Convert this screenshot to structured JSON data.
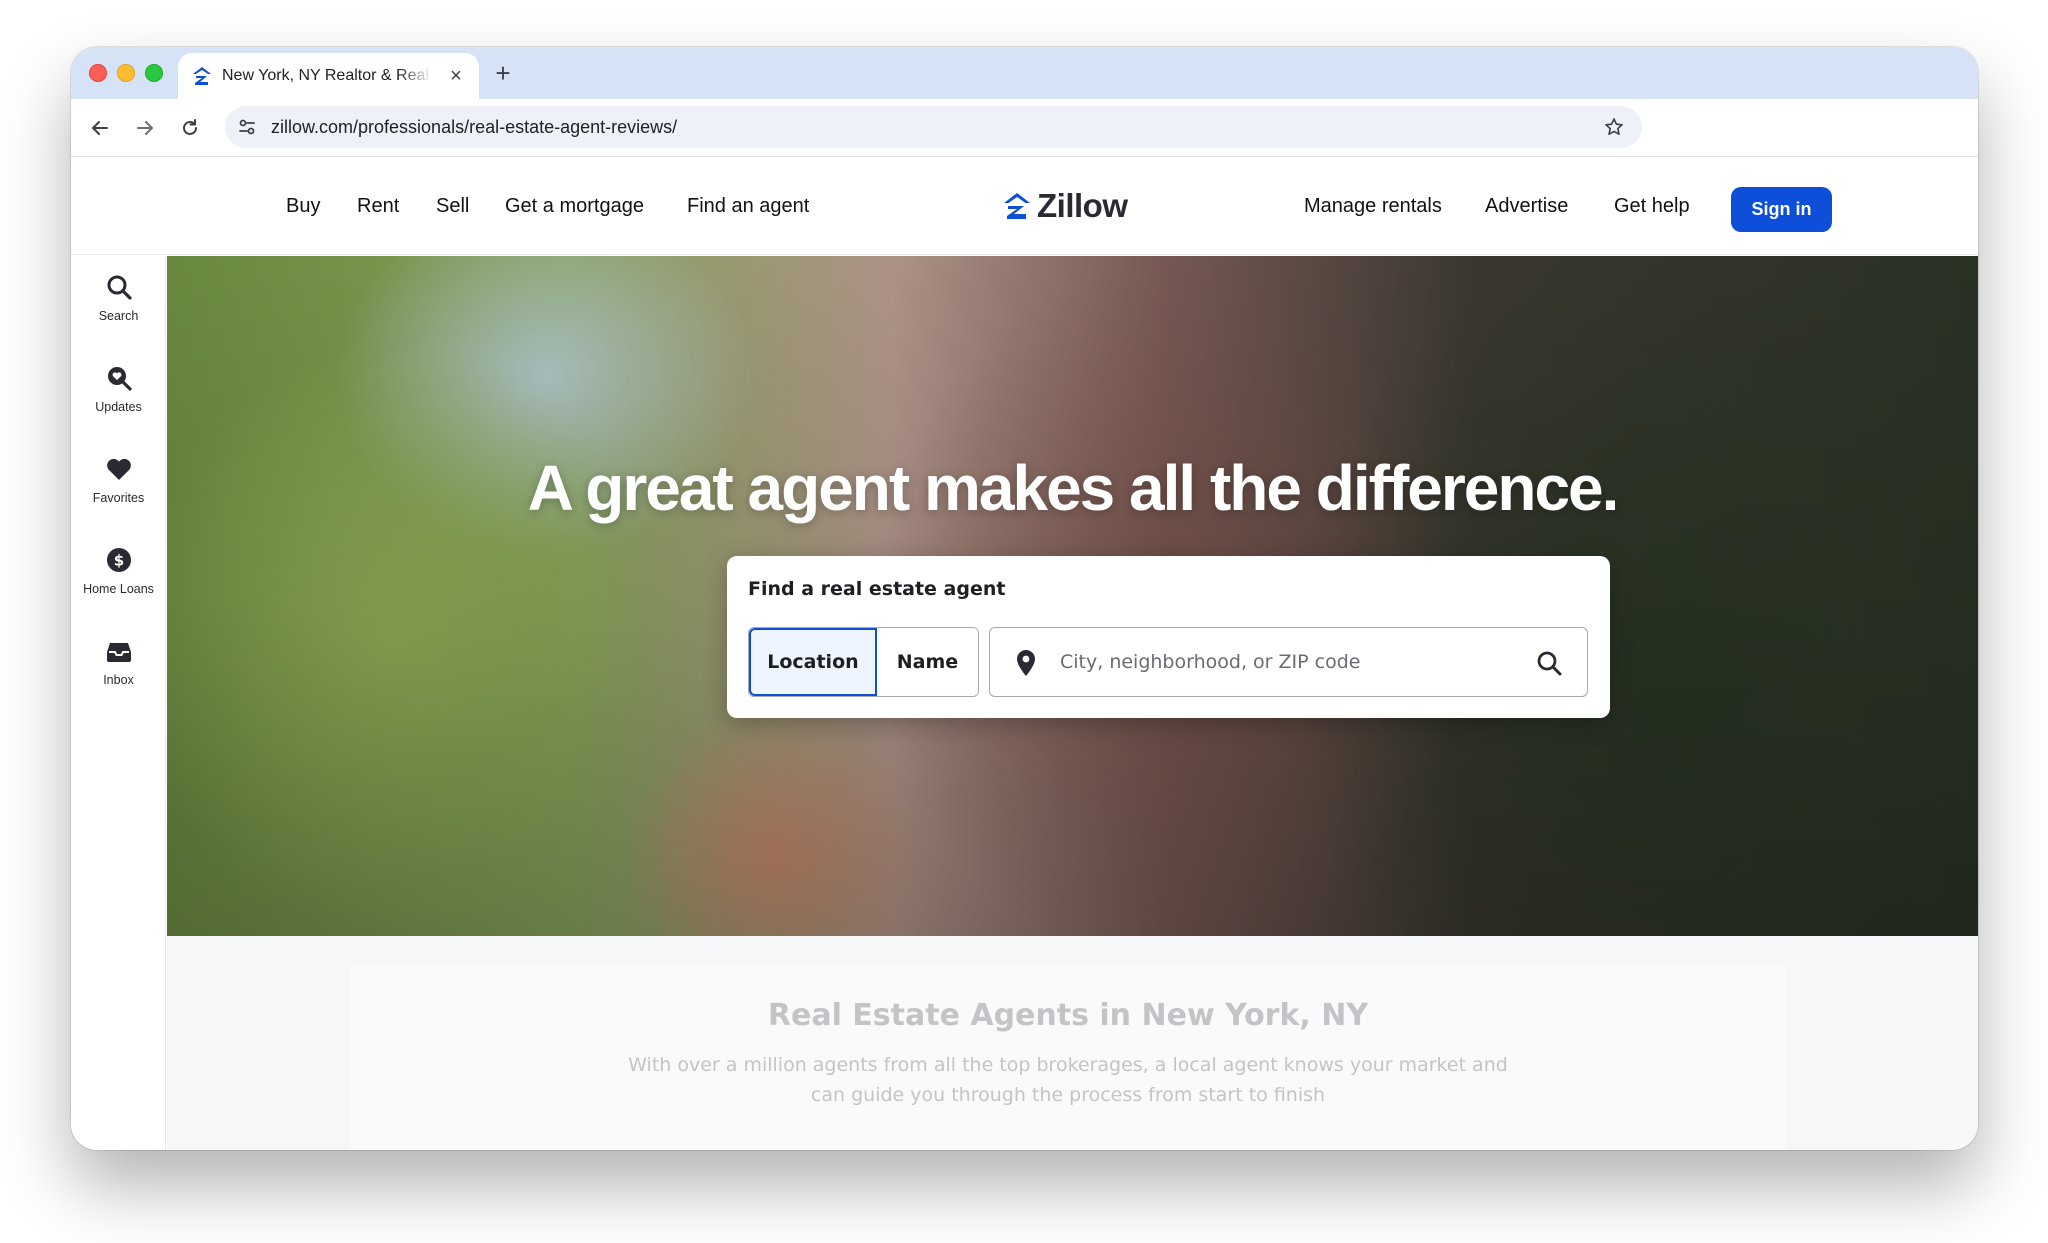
{
  "browser": {
    "tab_title": "New York, NY Realtor & Real Estate Agent Reviews",
    "url": "zillow.com/professionals/real-estate-agent-reviews/"
  },
  "header": {
    "nav_left": [
      "Buy",
      "Rent",
      "Sell",
      "Get a mortgage",
      "Find an agent"
    ],
    "logo_text": "Zillow",
    "nav_right": [
      "Manage rentals",
      "Advertise",
      "Get help"
    ],
    "signin_label": "Sign in"
  },
  "sidebar": {
    "items": [
      {
        "label": "Search",
        "icon": "search-icon"
      },
      {
        "label": "Updates",
        "icon": "updates-icon"
      },
      {
        "label": "Favorites",
        "icon": "heart-icon"
      },
      {
        "label": "Home Loans",
        "icon": "dollar-icon"
      },
      {
        "label": "Inbox",
        "icon": "inbox-icon"
      }
    ]
  },
  "hero": {
    "headline": "A great agent makes all the difference.",
    "card_title": "Find a real estate agent",
    "toggle_location": "Location",
    "toggle_name": "Name",
    "search_placeholder": "City, neighborhood, or ZIP code"
  },
  "content": {
    "title": "Real Estate Agents in New York, NY",
    "subtitle_line1": "With over a million agents from all the top brokerages, a local agent knows your market and",
    "subtitle_line2": "can guide you through the process from start to finish"
  },
  "colors": {
    "brand_blue": "#0d4fd8",
    "tab_bar": "#d6e2f6"
  }
}
